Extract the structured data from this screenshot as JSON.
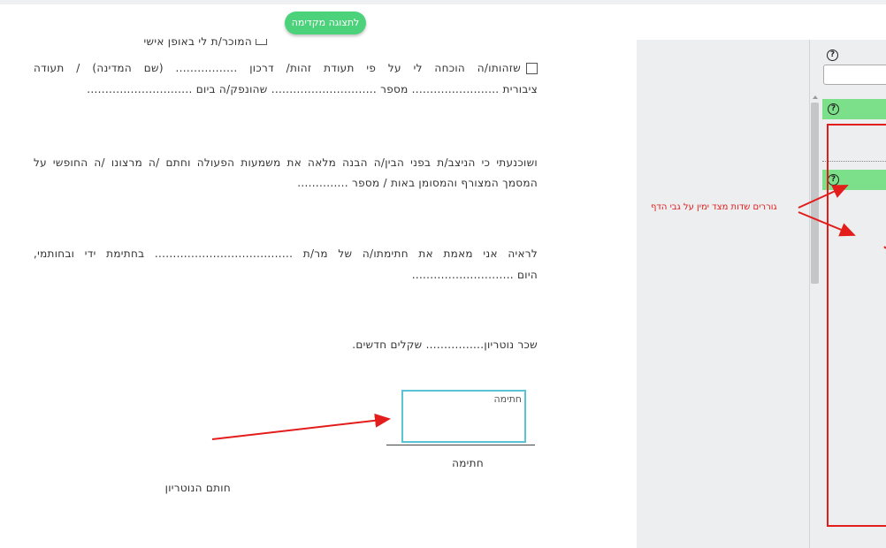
{
  "toolbar": {
    "preview_button": "לתצוגה מקדימה"
  },
  "document": {
    "line_personally": "המוכר/ת לי באופן אישי",
    "identity_line1": "שזהותו/ה הוכחה לי על פי תעודת זהות/ דרכון ................. (שם המדינה) / תעודה",
    "identity_line2": "ציבורית ........................ מספר ............................. שהונפק/ה ביום .............................",
    "convinced_line1": "ושוכנעתי כי הניצב/ת בפני הבין/ה הבנה מלאה את משמעות הפעולה וחתם /ה מרצונו /ה החופשי על",
    "convinced_line2": "המסמך המצורף והמסומן באות / מספר ..............",
    "attest_line1": "לראיה אני מאמת את חתימתו/ה של מר/ת ...................................... בחתימת ידי ובחותמי,",
    "attest_line2": "היום ............................",
    "fee_line": "שכר נוטריון................ שקלים חדשים.",
    "signature_box_label": "חתימה",
    "signature_caption": "חתימה",
    "notary_stamp": "חותם הנוטריון"
  },
  "panel": {
    "help_symbol": "?",
    "annotation": "גוררים שדות מצד ימין על גבי הדף"
  },
  "colors": {
    "accent_green": "#4cd27b",
    "field_green": "#7be089",
    "annotation_red": "#e31c1c",
    "signature_box": "#5bc4d4"
  },
  "icons": [
    "help-circle-icon",
    "checkbox-icon"
  ]
}
